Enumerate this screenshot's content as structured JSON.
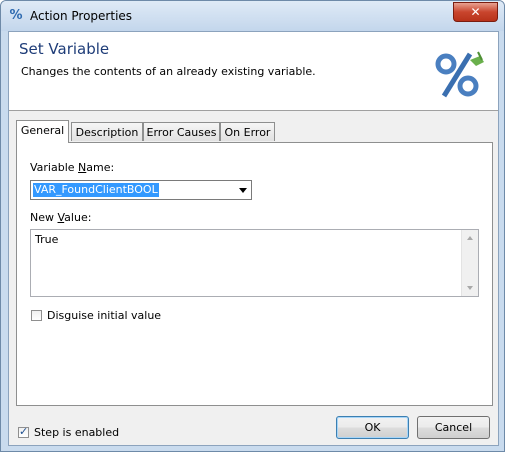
{
  "window": {
    "title": "Action Properties",
    "close_glyph": "✕",
    "app_icon": "percent-wrench-icon"
  },
  "header": {
    "title": "Set Variable",
    "description": "Changes the contents of an already existing variable.",
    "icon": "variable-percent-icon"
  },
  "tabs": [
    {
      "label": "General",
      "active": true
    },
    {
      "label": "Description",
      "active": false
    },
    {
      "label": "Error Causes",
      "active": false
    },
    {
      "label": "On Error",
      "active": false
    }
  ],
  "general": {
    "variable_name_label_pre": "Variable ",
    "variable_name_label_ul": "N",
    "variable_name_label_post": "ame:",
    "variable_name_value": "VAR_FoundClientBOOL",
    "new_value_label_pre": "New ",
    "new_value_label_ul": "V",
    "new_value_label_post": "alue:",
    "new_value_text": "True",
    "disguise_label": "Disguise initial value",
    "disguise_checked": false
  },
  "footer": {
    "step_enabled_label": "Step is enabled",
    "step_enabled_checked": true,
    "ok_label": "OK",
    "cancel_label": "Cancel"
  },
  "colors": {
    "accent": "#1e3c78",
    "selection": "#3399ff",
    "close": "#c9452d"
  }
}
